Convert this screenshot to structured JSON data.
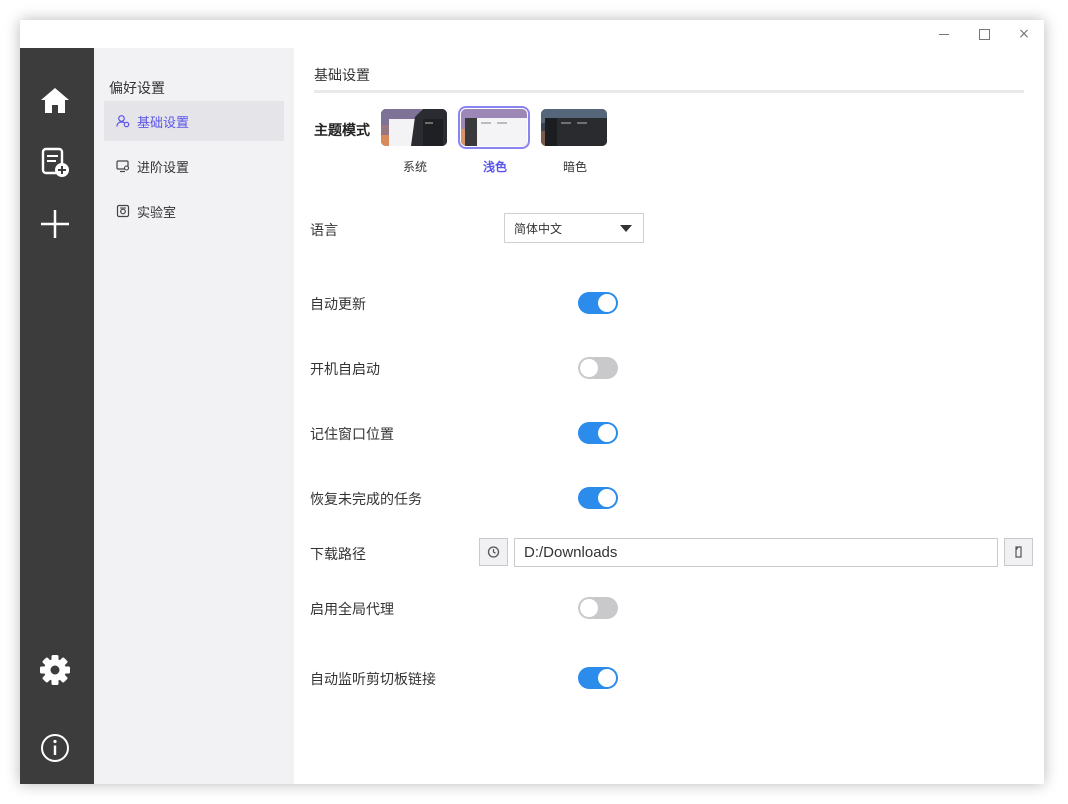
{
  "window": {
    "controls": {
      "minimize": "min-icon",
      "maximize": "max-icon",
      "close": "×"
    }
  },
  "rail": {
    "icons": [
      "home-icon",
      "add-task-icon",
      "plus-icon",
      "settings-icon",
      "info-icon"
    ]
  },
  "nav": {
    "header": "偏好设置",
    "items": [
      {
        "label": "基础设置",
        "icon": "user-gear-icon",
        "active": true
      },
      {
        "label": "进阶设置",
        "icon": "monitor-gear-icon",
        "active": false
      },
      {
        "label": "实验室",
        "icon": "lab-icon",
        "active": false
      }
    ]
  },
  "content": {
    "section_title": "基础设置",
    "theme": {
      "label": "主题模式",
      "options": [
        {
          "label": "系统",
          "selected": false
        },
        {
          "label": "浅色",
          "selected": true
        },
        {
          "label": "暗色",
          "selected": false
        }
      ]
    },
    "language": {
      "label": "语言",
      "value": "简体中文"
    },
    "settings": [
      {
        "label": "自动更新",
        "enabled": true
      },
      {
        "label": "开机自启动",
        "enabled": false
      },
      {
        "label": "记住窗口位置",
        "enabled": true
      },
      {
        "label": "恢复未完成的任务",
        "enabled": true
      }
    ],
    "download_path": {
      "label": "下载路径",
      "value": "D:/Downloads"
    },
    "proxy": {
      "label": "启用全局代理",
      "enabled": false
    },
    "clipboard": {
      "label": "自动监听剪切板链接",
      "enabled": true
    }
  },
  "colors": {
    "accent": "#5b55e8",
    "toggle_on": "#2b8ceb",
    "rail": "#3c3c3c",
    "nav_bg": "#f2f2f5"
  }
}
